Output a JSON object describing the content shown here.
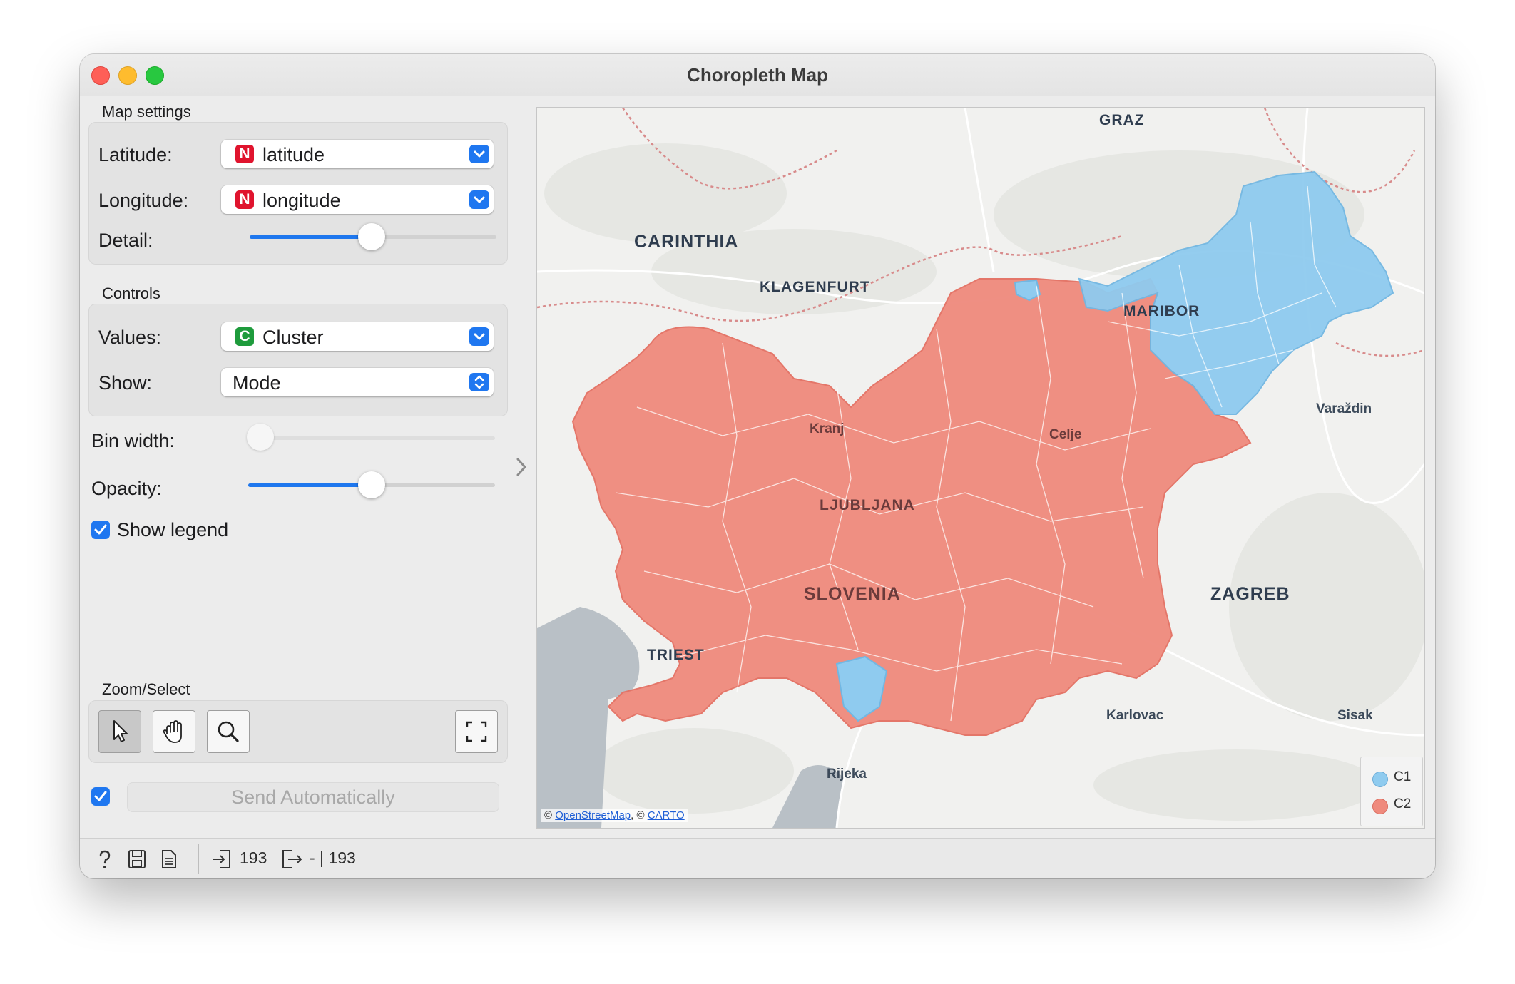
{
  "window": {
    "title": "Choropleth Map"
  },
  "map_settings": {
    "title": "Map settings",
    "latitude_label": "Latitude:",
    "latitude_value": "latitude",
    "latitude_type": "N",
    "longitude_label": "Longitude:",
    "longitude_value": "longitude",
    "longitude_type": "N",
    "detail_label": "Detail:",
    "detail_level": 0.5
  },
  "controls": {
    "title": "Controls",
    "values_label": "Values:",
    "values_value": "Cluster",
    "values_type": "C",
    "show_label": "Show:",
    "show_value": "Mode",
    "bin_width_label": "Bin width:",
    "bin_width_level": 0.0,
    "opacity_label": "Opacity:",
    "opacity_level": 0.5,
    "show_legend_label": "Show legend",
    "show_legend_checked": true
  },
  "zoom_select": {
    "title": "Zoom/Select",
    "tools": [
      "pointer-tool",
      "pan-tool",
      "zoom-tool",
      "fit-view"
    ]
  },
  "send": {
    "label": "Send Automatically",
    "checked": true
  },
  "map": {
    "labels": {
      "graz": "GRAZ",
      "carinthia": "CARINTHIA",
      "klagenfurt": "KLAGENFURT",
      "maribor": "MARIBOR",
      "varazdin": "Varaždin",
      "kranj": "Kranj",
      "celje": "Celje",
      "ljubljana": "LJUBLJANA",
      "slovenia": "SLOVENIA",
      "zagreb": "ZAGREB",
      "trieste": "TRIEST",
      "karlovac": "Karlovac",
      "sisak": "Sisak",
      "rijeka": "Rijeka"
    },
    "attribution_prefix": "©",
    "attribution_osm": "OpenStreetMap",
    "attribution_sep": ", ©",
    "attribution_carto": "CARTO",
    "colors": {
      "C1": "#8fcbef",
      "C2": "#ef8a7d",
      "land": "#f1f1ef",
      "sea": "#b9c0c6"
    }
  },
  "legend": {
    "items": [
      {
        "label": "C1",
        "color": "#8fcbef"
      },
      {
        "label": "C2",
        "color": "#ef8a7d"
      }
    ]
  },
  "status": {
    "input_count": "193",
    "output_count": "- | 193"
  }
}
